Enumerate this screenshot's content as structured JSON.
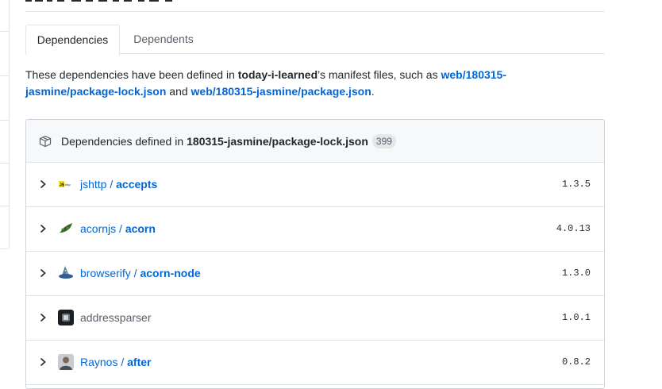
{
  "tabs": {
    "dependencies": "Dependencies",
    "dependents": "Dependents"
  },
  "intro": {
    "part1": "These dependencies have been defined in ",
    "repo": "today-i-learned",
    "part2": "’s manifest files, such as ",
    "file1": "web/180315-jasmine/package-lock.json",
    "part3": " and ",
    "file2": "web/180315-jasmine/package.json",
    "part4": "."
  },
  "box": {
    "header_prefix": "Dependencies defined in",
    "header_file": "180315-jasmine/package-lock.json",
    "count": "399"
  },
  "dependencies": [
    {
      "owner": "jshttp",
      "sep": " / ",
      "repo": "accepts",
      "version": "1.3.5",
      "icon": "jshttp-logo"
    },
    {
      "owner": "acornjs",
      "sep": " / ",
      "repo": "acorn",
      "version": "4.0.13",
      "icon": "acorn-leaf-logo"
    },
    {
      "owner": "browserify",
      "sep": " / ",
      "repo": "acorn-node",
      "version": "1.3.0",
      "icon": "wizard-hat-logo"
    },
    {
      "name": "addressparser",
      "version": "1.0.1",
      "icon": "package-avatar"
    },
    {
      "owner": "Raynos",
      "sep": " / ",
      "repo": "after",
      "version": "0.8.2",
      "icon": "user-avatar"
    }
  ],
  "colors": {
    "link": "#0366d6",
    "border": "#e1e4e8",
    "header_bg": "#f6f8fa"
  }
}
